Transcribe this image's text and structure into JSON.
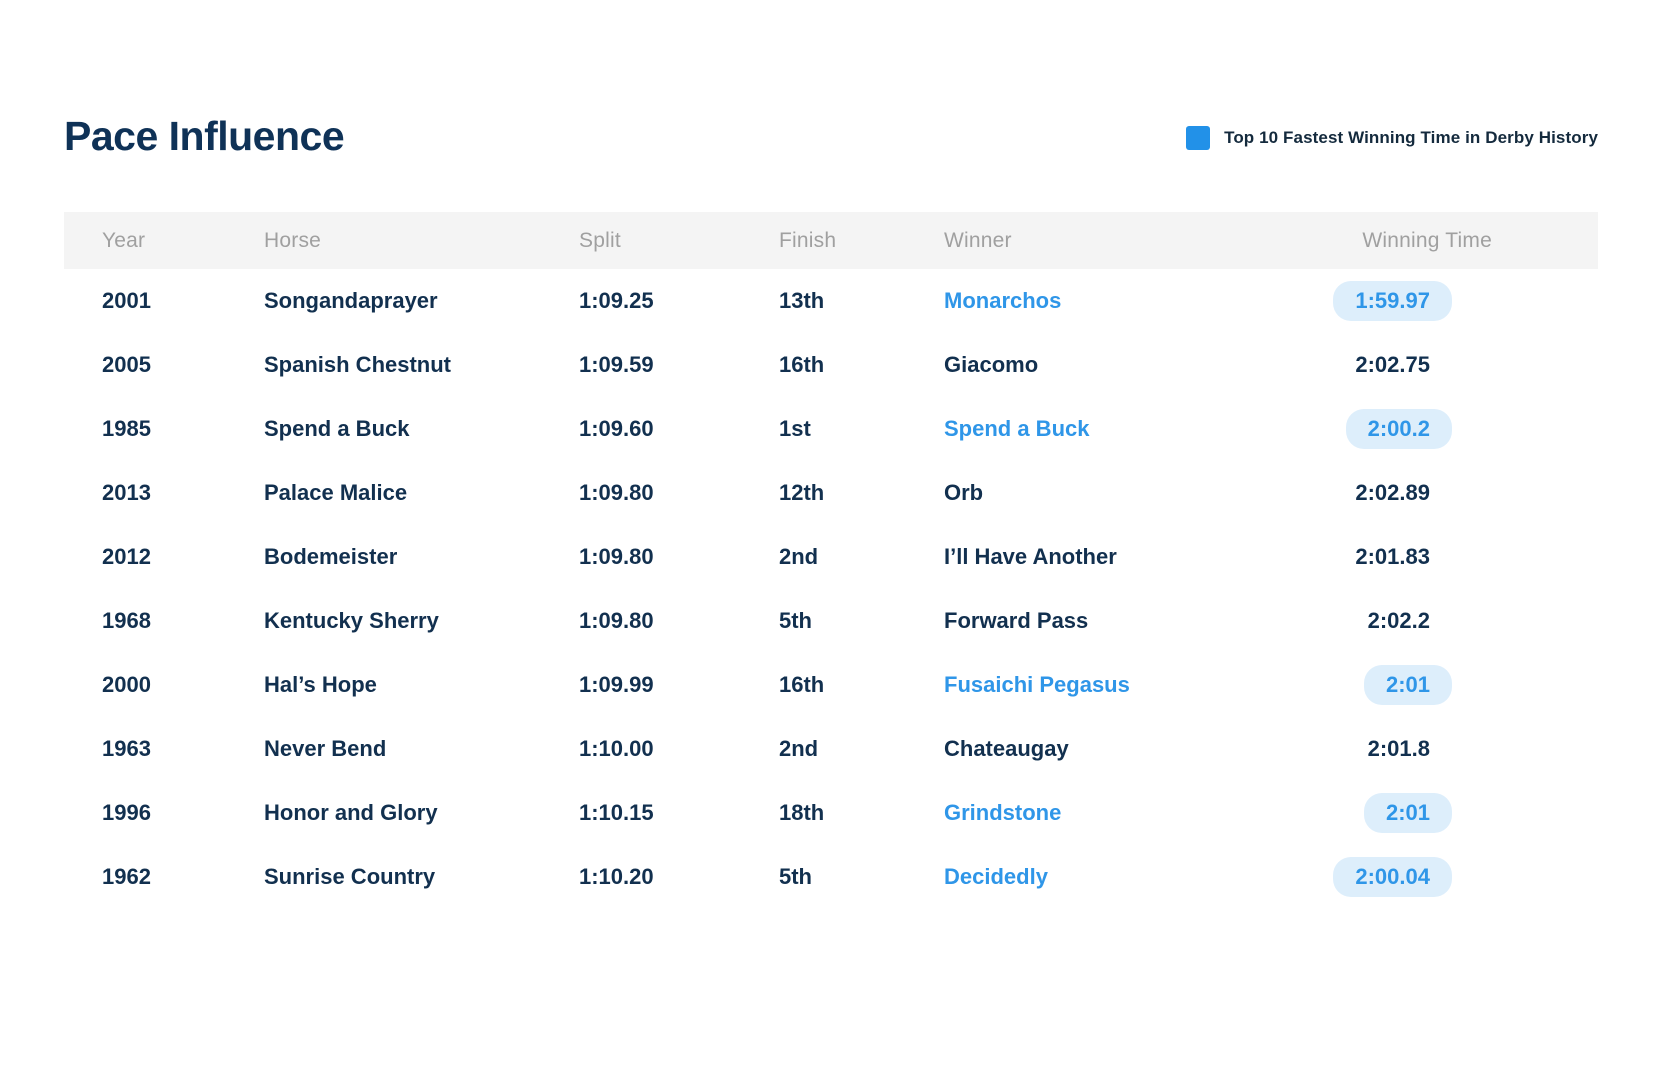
{
  "header": {
    "title": "Pace Influence",
    "legend": {
      "swatch_color": "#2291e8",
      "label": "Top 10 Fastest Winning Time in Derby History"
    }
  },
  "colors": {
    "title": "#0f3257",
    "text": "#12304f",
    "header_text": "#a0a0a0",
    "header_bg": "#f4f4f4",
    "accent_blue": "#2f96e8",
    "pill_bg": "#ddeefb"
  },
  "table": {
    "columns": [
      {
        "key": "year",
        "label": "Year"
      },
      {
        "key": "horse",
        "label": "Horse"
      },
      {
        "key": "split",
        "label": "Split"
      },
      {
        "key": "finish",
        "label": "Finish"
      },
      {
        "key": "winner",
        "label": "Winner"
      },
      {
        "key": "time",
        "label": "Winning Time"
      }
    ],
    "rows": [
      {
        "year": "2001",
        "horse": "Songandaprayer",
        "split": "1:09.25",
        "finish": "13th",
        "winner": "Monarchos",
        "time": "1:59.97",
        "highlight": true
      },
      {
        "year": "2005",
        "horse": "Spanish Chestnut",
        "split": "1:09.59",
        "finish": "16th",
        "winner": "Giacomo",
        "time": "2:02.75",
        "highlight": false
      },
      {
        "year": "1985",
        "horse": "Spend a Buck",
        "split": "1:09.60",
        "finish": "1st",
        "winner": "Spend a Buck",
        "time": "2:00.2",
        "highlight": true
      },
      {
        "year": "2013",
        "horse": "Palace Malice",
        "split": "1:09.80",
        "finish": "12th",
        "winner": "Orb",
        "time": "2:02.89",
        "highlight": false
      },
      {
        "year": "2012",
        "horse": "Bodemeister",
        "split": "1:09.80",
        "finish": "2nd",
        "winner": "I’ll Have Another",
        "time": "2:01.83",
        "highlight": false
      },
      {
        "year": "1968",
        "horse": "Kentucky Sherry",
        "split": "1:09.80",
        "finish": "5th",
        "winner": "Forward Pass",
        "time": "2:02.2",
        "highlight": false
      },
      {
        "year": "2000",
        "horse": "Hal’s Hope",
        "split": "1:09.99",
        "finish": "16th",
        "winner": "Fusaichi Pegasus",
        "time": "2:01",
        "highlight": true
      },
      {
        "year": "1963",
        "horse": "Never Bend",
        "split": "1:10.00",
        "finish": "2nd",
        "winner": "Chateaugay",
        "time": "2:01.8",
        "highlight": false
      },
      {
        "year": "1996",
        "horse": "Honor and Glory",
        "split": "1:10.15",
        "finish": "18th",
        "winner": "Grindstone",
        "time": "2:01",
        "highlight": true
      },
      {
        "year": "1962",
        "horse": "Sunrise Country",
        "split": "1:10.20",
        "finish": "5th",
        "winner": "Decidedly",
        "time": "2:00.04",
        "highlight": true
      }
    ]
  }
}
